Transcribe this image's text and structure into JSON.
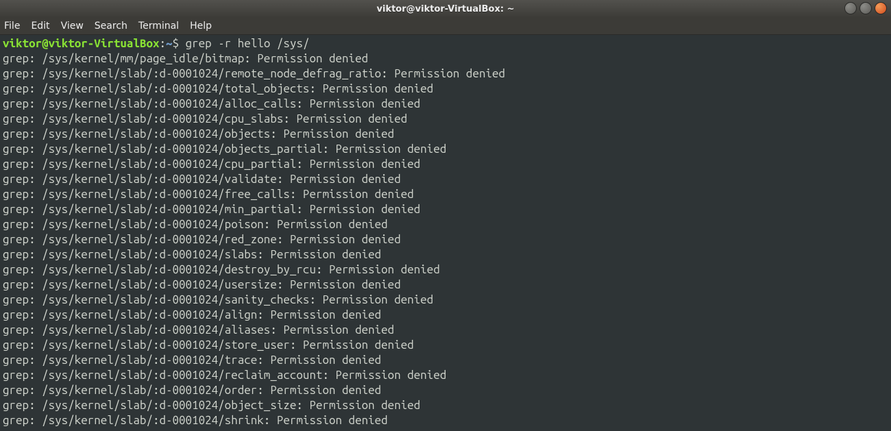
{
  "window": {
    "title": "viktor@viktor-VirtualBox: ~"
  },
  "menubar": {
    "items": [
      "File",
      "Edit",
      "View",
      "Search",
      "Terminal",
      "Help"
    ]
  },
  "prompt": {
    "user": "viktor",
    "at": "@",
    "host": "viktor-VirtualBox",
    "colon": ":",
    "path": "~",
    "dollar": "$"
  },
  "command": " grep -r hello /sys/",
  "output_lines": [
    "grep: /sys/kernel/mm/page_idle/bitmap: Permission denied",
    "grep: /sys/kernel/slab/:d-0001024/remote_node_defrag_ratio: Permission denied",
    "grep: /sys/kernel/slab/:d-0001024/total_objects: Permission denied",
    "grep: /sys/kernel/slab/:d-0001024/alloc_calls: Permission denied",
    "grep: /sys/kernel/slab/:d-0001024/cpu_slabs: Permission denied",
    "grep: /sys/kernel/slab/:d-0001024/objects: Permission denied",
    "grep: /sys/kernel/slab/:d-0001024/objects_partial: Permission denied",
    "grep: /sys/kernel/slab/:d-0001024/cpu_partial: Permission denied",
    "grep: /sys/kernel/slab/:d-0001024/validate: Permission denied",
    "grep: /sys/kernel/slab/:d-0001024/free_calls: Permission denied",
    "grep: /sys/kernel/slab/:d-0001024/min_partial: Permission denied",
    "grep: /sys/kernel/slab/:d-0001024/poison: Permission denied",
    "grep: /sys/kernel/slab/:d-0001024/red_zone: Permission denied",
    "grep: /sys/kernel/slab/:d-0001024/slabs: Permission denied",
    "grep: /sys/kernel/slab/:d-0001024/destroy_by_rcu: Permission denied",
    "grep: /sys/kernel/slab/:d-0001024/usersize: Permission denied",
    "grep: /sys/kernel/slab/:d-0001024/sanity_checks: Permission denied",
    "grep: /sys/kernel/slab/:d-0001024/align: Permission denied",
    "grep: /sys/kernel/slab/:d-0001024/aliases: Permission denied",
    "grep: /sys/kernel/slab/:d-0001024/store_user: Permission denied",
    "grep: /sys/kernel/slab/:d-0001024/trace: Permission denied",
    "grep: /sys/kernel/slab/:d-0001024/reclaim_account: Permission denied",
    "grep: /sys/kernel/slab/:d-0001024/order: Permission denied",
    "grep: /sys/kernel/slab/:d-0001024/object_size: Permission denied",
    "grep: /sys/kernel/slab/:d-0001024/shrink: Permission denied"
  ]
}
